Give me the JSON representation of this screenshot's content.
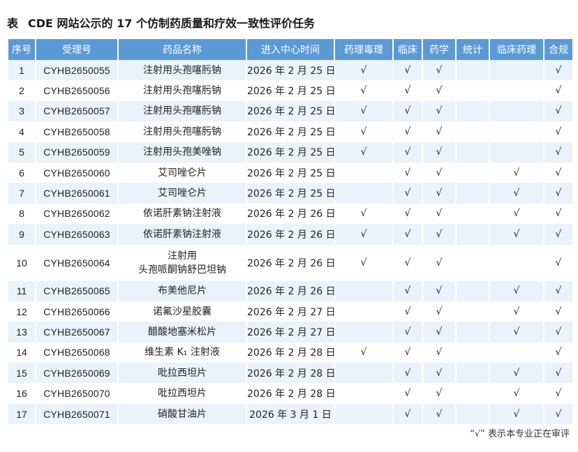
{
  "title": {
    "tag": "表",
    "text": "CDE 网站公示的 17 个仿制药质量和疗效一致性评价任务"
  },
  "table": {
    "headers": [
      "序号",
      "受理号",
      "药品名称",
      "进入中心时间",
      "药理毒理",
      "临床",
      "药学",
      "统计",
      "临床药理",
      "合规"
    ],
    "rows": [
      {
        "no": "1",
        "code": "CYHB2650055",
        "drug": [
          "注射用头孢噻肟钠"
        ],
        "date": "2026 年 2 月 25 日",
        "marks": [
          "√",
          "√",
          "√",
          "",
          "",
          "√"
        ]
      },
      {
        "no": "2",
        "code": "CYHB2650056",
        "drug": [
          "注射用头孢噻肟钠"
        ],
        "date": "2026 年 2 月 25 日",
        "marks": [
          "√",
          "√",
          "√",
          "",
          "",
          "√"
        ]
      },
      {
        "no": "3",
        "code": "CYHB2650057",
        "drug": [
          "注射用头孢噻肟钠"
        ],
        "date": "2026 年 2 月 25 日",
        "marks": [
          "√",
          "√",
          "√",
          "",
          "",
          "√"
        ]
      },
      {
        "no": "4",
        "code": "CYHB2650058",
        "drug": [
          "注射用头孢噻肟钠"
        ],
        "date": "2026 年 2 月 25 日",
        "marks": [
          "√",
          "√",
          "√",
          "",
          "",
          "√"
        ]
      },
      {
        "no": "5",
        "code": "CYHB2650059",
        "drug": [
          "注射用头孢美唑钠"
        ],
        "date": "2026 年 2 月 25 日",
        "marks": [
          "√",
          "√",
          "√",
          "",
          "",
          "√"
        ]
      },
      {
        "no": "6",
        "code": "CYHB2650060",
        "drug": [
          "艾司唑仑片"
        ],
        "date": "2026 年 2 月 25 日",
        "marks": [
          "",
          "√",
          "√",
          "",
          "√",
          "√"
        ]
      },
      {
        "no": "7",
        "code": "CYHB2650061",
        "drug": [
          "艾司唑仑片"
        ],
        "date": "2026 年 2 月 25 日",
        "marks": [
          "",
          "√",
          "√",
          "",
          "√",
          "√"
        ]
      },
      {
        "no": "8",
        "code": "CYHB2650062",
        "drug": [
          "依诺肝素钠注射液"
        ],
        "date": "2026 年 2 月 26 日",
        "marks": [
          "√",
          "√",
          "√",
          "",
          "√",
          "√"
        ]
      },
      {
        "no": "9",
        "code": "CYHB2650063",
        "drug": [
          "依诺肝素钠注射液"
        ],
        "date": "2026 年 2 月 26 日",
        "marks": [
          "√",
          "√",
          "√",
          "",
          "√",
          "√"
        ]
      },
      {
        "no": "10",
        "code": "CYHB2650064",
        "drug": [
          "注射用",
          "头孢哌酮钠舒巴坦钠"
        ],
        "date": "2026 年 2 月 26 日",
        "marks": [
          "√",
          "√",
          "√",
          "",
          "",
          "√"
        ]
      },
      {
        "no": "11",
        "code": "CYHB2650065",
        "drug": [
          "布美他尼片"
        ],
        "date": "2026 年 2 月 26 日",
        "marks": [
          "",
          "√",
          "√",
          "",
          "√",
          "√"
        ]
      },
      {
        "no": "12",
        "code": "CYHB2650066",
        "drug": [
          "诺氟沙星胶囊"
        ],
        "date": "2026 年 2 月 27 日",
        "marks": [
          "",
          "√",
          "√",
          "",
          "√",
          "√"
        ]
      },
      {
        "no": "13",
        "code": "CYHB2650067",
        "drug": [
          "醋酸地塞米松片"
        ],
        "date": "2026 年 2 月 27 日",
        "marks": [
          "",
          "√",
          "√",
          "",
          "√",
          "√"
        ]
      },
      {
        "no": "14",
        "code": "CYHB2650068",
        "drug": [
          "维生素 K₁ 注射液"
        ],
        "date": "2026 年 2 月 28 日",
        "marks": [
          "√",
          "√",
          "√",
          "",
          "",
          "√"
        ]
      },
      {
        "no": "15",
        "code": "CYHB2650069",
        "drug": [
          "吡拉西坦片"
        ],
        "date": "2026 年 2 月 28 日",
        "marks": [
          "",
          "√",
          "√",
          "",
          "√",
          "√"
        ]
      },
      {
        "no": "16",
        "code": "CYHB2650070",
        "drug": [
          "吡拉西坦片"
        ],
        "date": "2026 年 2 月 28 日",
        "marks": [
          "",
          "√",
          "√",
          "",
          "√",
          "√"
        ]
      },
      {
        "no": "17",
        "code": "CYHB2650071",
        "drug": [
          "硝酸甘油片"
        ],
        "date": "2026 年 3 月 1 日",
        "marks": [
          "",
          "√",
          "√",
          "",
          "√",
          "√"
        ]
      }
    ]
  },
  "note": "“√” 表示本专业正在审评",
  "colors": {
    "header": "#5a9ad6",
    "stripe": "#eaf2fb"
  }
}
